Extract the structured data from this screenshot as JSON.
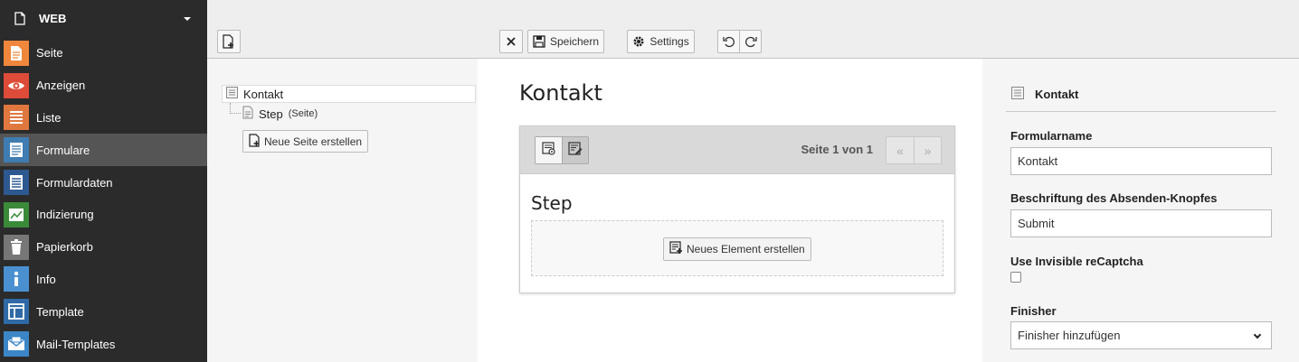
{
  "sidebar": {
    "group_label": "WEB",
    "items": [
      {
        "label": "Seite",
        "icon": "page-icon",
        "color": "#f0873c",
        "active": false
      },
      {
        "label": "Anzeigen",
        "icon": "eye-icon",
        "color": "#dd4b39",
        "active": false
      },
      {
        "label": "Liste",
        "icon": "list-icon",
        "color": "#e0773e",
        "active": false
      },
      {
        "label": "Formulare",
        "icon": "form-icon",
        "color": "#3e7cb1",
        "active": true
      },
      {
        "label": "Formulardaten",
        "icon": "form-data-icon",
        "color": "#2d5890",
        "active": false
      },
      {
        "label": "Indizierung",
        "icon": "chart-icon",
        "color": "#3a8a3a",
        "active": false
      },
      {
        "label": "Papierkorb",
        "icon": "trash-icon",
        "color": "#777777",
        "active": false
      },
      {
        "label": "Info",
        "icon": "info-icon",
        "color": "#4a90d0",
        "active": false
      },
      {
        "label": "Template",
        "icon": "template-icon",
        "color": "#2f6aa6",
        "active": false
      },
      {
        "label": "Mail-Templates",
        "icon": "mail-icon",
        "color": "#3b86c6",
        "active": false
      }
    ]
  },
  "toolbar": {
    "save_label": "Speichern",
    "settings_label": "Settings"
  },
  "tree": {
    "root_label": "Kontakt",
    "child_label": "Step",
    "child_type": "(Seite)",
    "new_page_label": "Neue Seite erstellen"
  },
  "stage": {
    "title": "Kontakt",
    "page_counter": "Seite 1 von 1",
    "step_title": "Step",
    "new_element_label": "Neues Element erstellen",
    "prev_label": "«",
    "next_label": "»"
  },
  "inspector": {
    "header": "Kontakt",
    "formname_label": "Formularname",
    "formname_value": "Kontakt",
    "submit_label": "Beschriftung des Absenden-Knopfes",
    "submit_value": "Submit",
    "recaptcha_label": "Use Invisible reCaptcha",
    "finisher_label": "Finisher",
    "finisher_selected": "Finisher hinzufügen"
  },
  "colors": {
    "sidebar_bg": "#2b2b2b",
    "sidebar_active": "#555555",
    "toolbar_bg": "#eeeeee"
  }
}
